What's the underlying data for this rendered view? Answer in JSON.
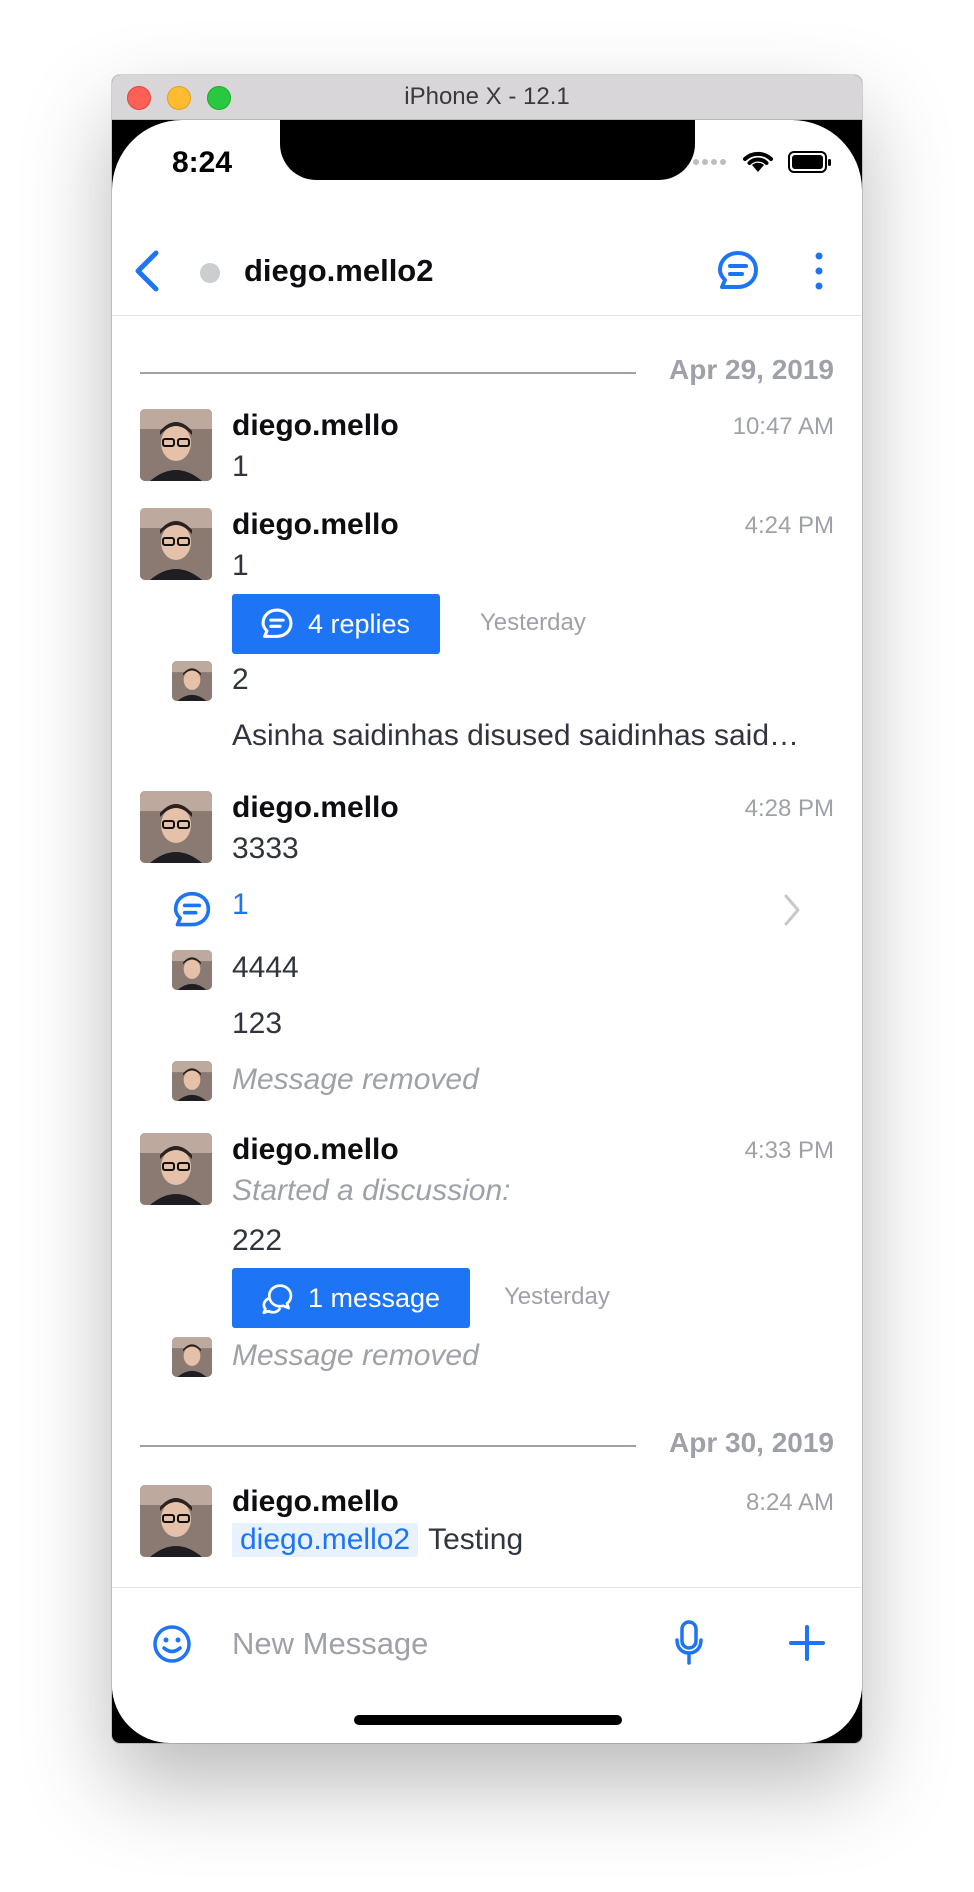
{
  "window": {
    "title": "iPhone X - 12.1"
  },
  "status_bar": {
    "time": "8:24"
  },
  "nav": {
    "room_name": "diego.mello2"
  },
  "dates": {
    "first": "Apr 29, 2019",
    "second": "Apr 30, 2019"
  },
  "messages": [
    {
      "user": "diego.mello",
      "time": "10:47 AM",
      "text": "1"
    },
    {
      "user": "diego.mello",
      "time": "4:24 PM",
      "text": "1",
      "thread_button": "4 replies",
      "thread_note": "Yesterday"
    },
    {
      "text": "2"
    },
    {
      "text": "Asinha saidinhas disused saidinhas said…"
    },
    {
      "user": "diego.mello",
      "time": "4:28 PM",
      "text": "3333"
    },
    {
      "thread_preview": "1"
    },
    {
      "text": "4444"
    },
    {
      "text": "123"
    },
    {
      "text": "Message removed"
    },
    {
      "user": "diego.mello",
      "time": "4:33 PM",
      "started": "Started a discussion:",
      "text": "222",
      "discussion_button": "1 message",
      "discussion_note": "Yesterday"
    },
    {
      "text": "Message removed"
    },
    {
      "user": "diego.mello",
      "time": "8:24 AM",
      "mention": "diego.mello2",
      "text": "Testing"
    }
  ],
  "composer": {
    "placeholder": "New Message"
  },
  "colors": {
    "accent": "#1d74f5",
    "muted": "#9ea2a8",
    "text": "#2f343d"
  },
  "icons": [
    "back-chevron-icon",
    "threads-icon",
    "kebab-icon",
    "emoji-icon",
    "microphone-icon",
    "plus-icon",
    "chevron-right-icon",
    "discussion-icon",
    "wifi-icon",
    "battery-icon",
    "signal-icon"
  ]
}
